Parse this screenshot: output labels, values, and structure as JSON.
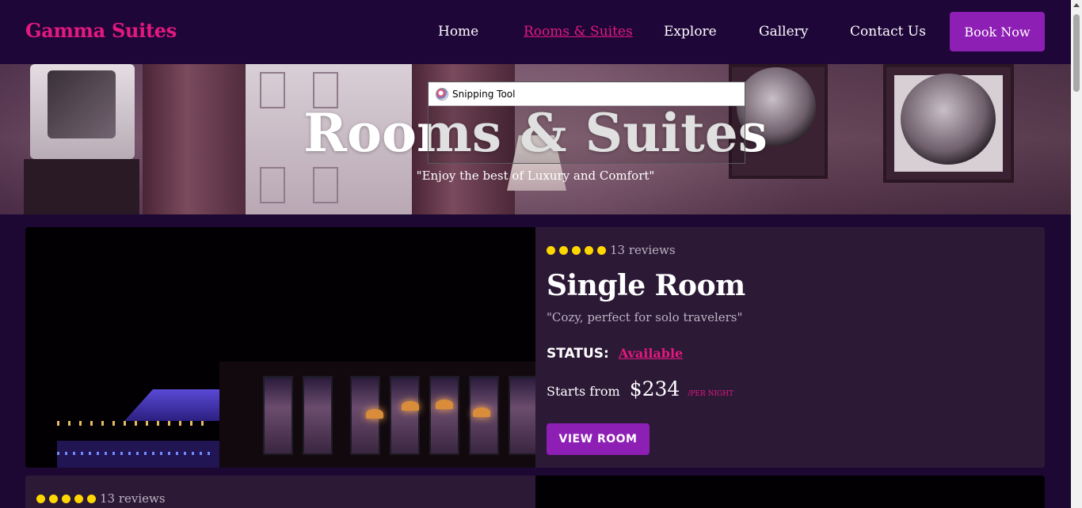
{
  "brand": {
    "name": "Gamma Suites",
    "accent": "#e3197f",
    "button_color": "#8e1fb5",
    "background": "#1c0833"
  },
  "nav": {
    "items": [
      {
        "label": "Home",
        "active": false
      },
      {
        "label": "Rooms & Suites",
        "active": true
      },
      {
        "label": "Explore",
        "active": false
      },
      {
        "label": "Gallery",
        "active": false
      },
      {
        "label": "Contact Us",
        "active": false
      }
    ],
    "cta_label": "Book Now"
  },
  "hero": {
    "title": "Rooms & Suites",
    "subtitle": "\"Enjoy the best of Luxury and Comfort\""
  },
  "snipping_tool": {
    "title": "Snipping Tool",
    "icon": "snipping-tool-icon"
  },
  "rooms": [
    {
      "rating_stars": 5,
      "reviews": "13 reviews",
      "name": "Single Room",
      "tagline": "\"Cozy, perfect for solo travelers\"",
      "status_label": "STATUS:",
      "status_value": "Available",
      "price_label": "Starts from",
      "price": "$234",
      "price_unit": "/PER NIGHT",
      "button_label": "VIEW ROOM"
    },
    {
      "rating_stars": 5,
      "reviews": "13 reviews"
    }
  ]
}
